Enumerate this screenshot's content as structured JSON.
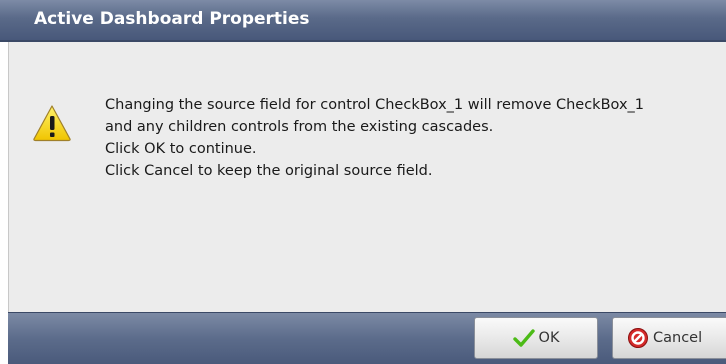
{
  "dialog": {
    "title": "Active Dashboard Properties",
    "icon": "warning-icon",
    "message_lines": [
      "Changing the source field for control CheckBox_1 will remove CheckBox_1",
      "and any children controls from the existing cascades.",
      "Click OK to continue.",
      "Click Cancel to keep the original source field."
    ]
  },
  "buttons": {
    "ok": {
      "label": "OK",
      "icon": "checkmark-icon"
    },
    "cancel": {
      "label": "Cancel",
      "icon": "cancel-icon"
    }
  },
  "colors": {
    "titlebar": "#5a6a89",
    "body_background": "#ececec",
    "warning_yellow": "#f5d31c",
    "ok_check": "#4cbb17",
    "cancel_red": "#d42a2a"
  }
}
